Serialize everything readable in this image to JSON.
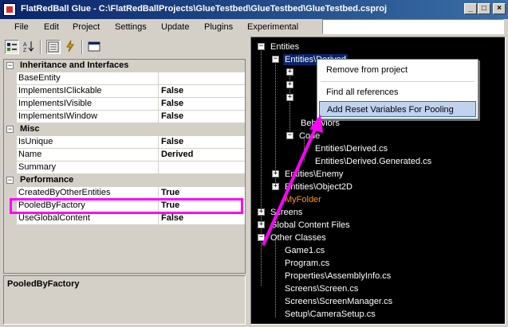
{
  "window": {
    "title": "FlatRedBall Glue - C:\\FlatRedBallProjects\\GlueTestbed\\GlueTestbed\\GlueTestbed.csproj",
    "minimize": "_",
    "maximize": "□",
    "close": "×"
  },
  "menu": {
    "items": [
      "File",
      "Edit",
      "Project",
      "Settings",
      "Update",
      "Plugins",
      "Experimental"
    ]
  },
  "properties": {
    "categories": [
      {
        "name": "Inheritance and Interfaces",
        "rows": [
          {
            "name": "BaseEntity",
            "value": ""
          },
          {
            "name": "ImplementsIClickable",
            "value": "False"
          },
          {
            "name": "ImplementsIVisible",
            "value": "False"
          },
          {
            "name": "ImplementsIWindow",
            "value": "False"
          }
        ]
      },
      {
        "name": "Misc",
        "rows": [
          {
            "name": "IsUnique",
            "value": "False"
          },
          {
            "name": "Name",
            "value": "Derived"
          },
          {
            "name": "Summary",
            "value": ""
          }
        ]
      },
      {
        "name": "Performance",
        "rows": [
          {
            "name": "CreatedByOtherEntities",
            "value": "True"
          },
          {
            "name": "PooledByFactory",
            "value": "True"
          },
          {
            "name": "UseGlobalContent",
            "value": "False"
          }
        ]
      }
    ],
    "collapse_glyph": "−",
    "description_title": "PooledByFactory"
  },
  "tree": {
    "entities": "Entities",
    "derived": "Entities\\Derived",
    "behaviors": "Behaviors",
    "code": "Code",
    "derived_cs": "Entities\\Derived.cs",
    "derived_generated_cs": "Entities\\Derived.Generated.cs",
    "enemy": "Entities\\Enemy",
    "object2d": "Entities\\Object2D",
    "my_folder": "MyFolder",
    "screens": "Screens",
    "global_content": "Global Content Files",
    "other_classes": "Other Classes",
    "game1": "Game1.cs",
    "program": "Program.cs",
    "assembly_info": "Properties\\AssemblyInfo.cs",
    "screen_cs": "Screens\\Screen.cs",
    "screen_manager": "Screens\\ScreenManager.cs",
    "camera_setup": "Setup\\CameraSetup.cs",
    "plus": "+",
    "minus": "−"
  },
  "context_menu": {
    "remove": "Remove from project",
    "find_refs": "Find all references",
    "add_reset": "Add Reset Variables For Pooling"
  },
  "colors": {
    "highlight": "#ff00ff",
    "selection": "#0a246a",
    "folder": "#ff9900"
  }
}
